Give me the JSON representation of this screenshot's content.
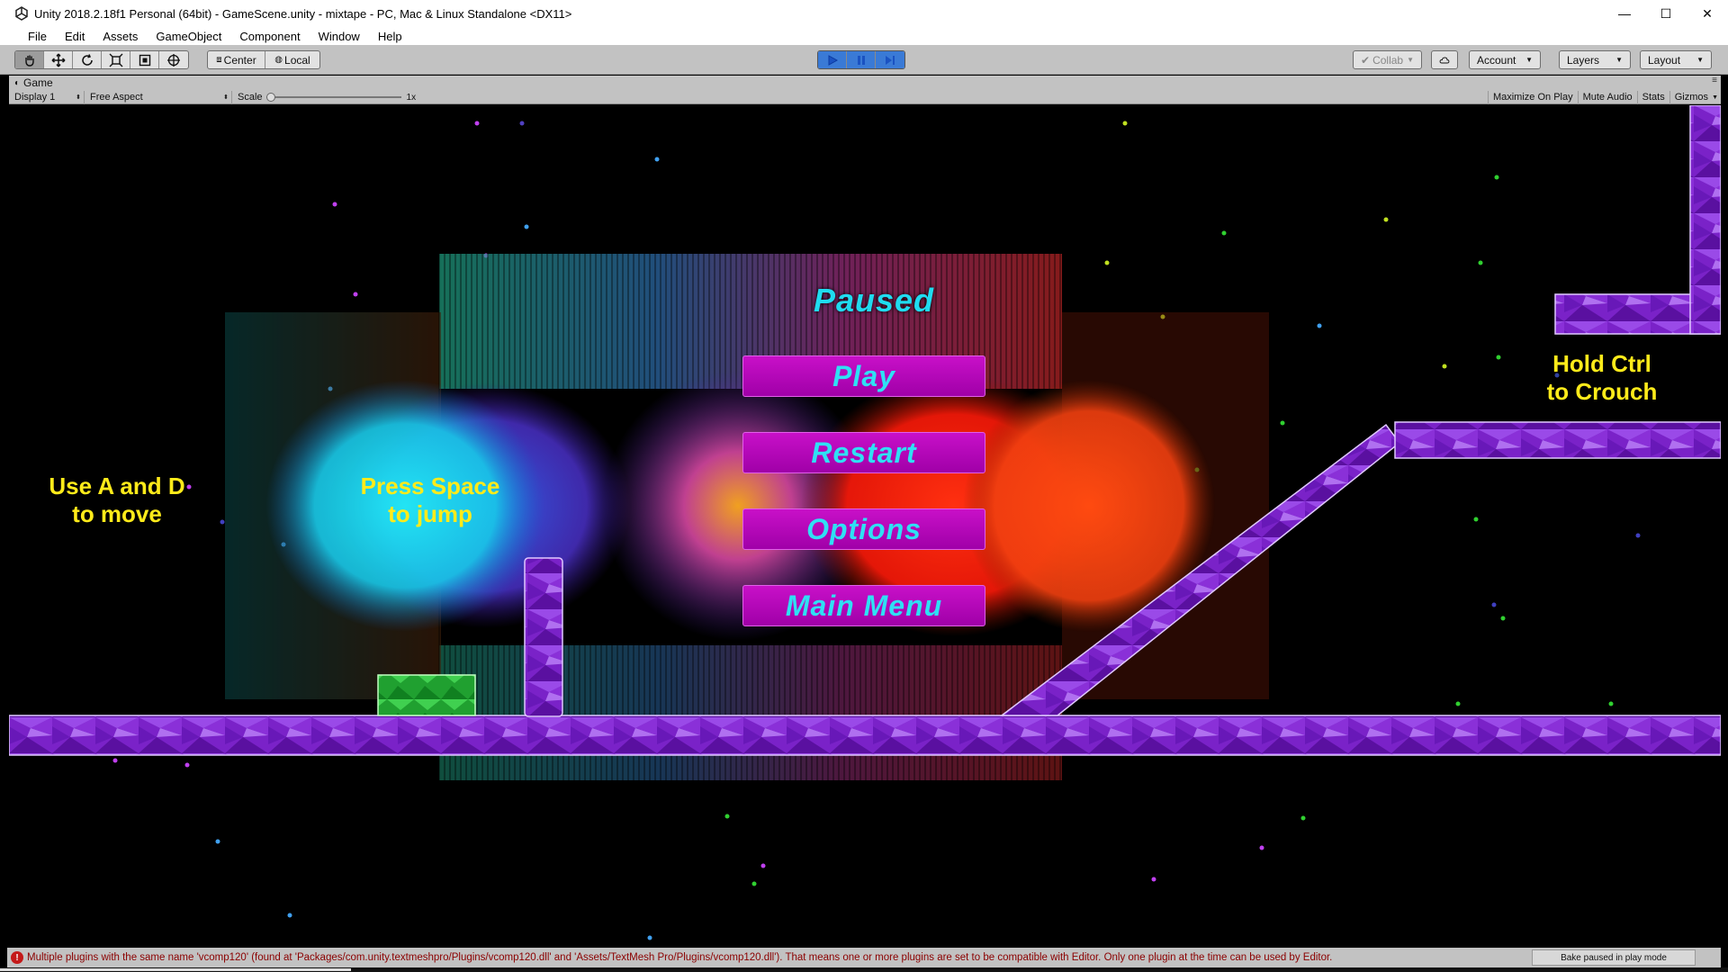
{
  "window": {
    "title": "Unity 2018.2.18f1 Personal (64bit) - GameScene.unity - mixtape - PC, Mac & Linux Standalone <DX11>",
    "minimize": "—",
    "maximize": "☐",
    "close": "✕"
  },
  "menu": [
    "File",
    "Edit",
    "Assets",
    "GameObject",
    "Component",
    "Window",
    "Help"
  ],
  "toolbar": {
    "pivot": "Center",
    "space": "Local",
    "collab": "Collab",
    "account": "Account",
    "layers": "Layers",
    "layout": "Layout"
  },
  "game_view": {
    "tab": "Game",
    "display": "Display 1",
    "aspect": "Free Aspect",
    "scale_label": "Scale",
    "scale_value": "1x",
    "maximize_on_play": "Maximize On Play",
    "mute_audio": "Mute Audio",
    "stats": "Stats",
    "gizmos": "Gizmos"
  },
  "game": {
    "paused_title": "Paused",
    "buttons": [
      "Play",
      "Restart",
      "Options",
      "Main Menu"
    ],
    "hint_move": [
      "Use A and D",
      "to move"
    ],
    "hint_jump": [
      "Press Space",
      "to jump"
    ],
    "hint_crouch": [
      "Hold Ctrl",
      "to Crouch"
    ]
  },
  "status": {
    "message": "Multiple plugins with the same name 'vcomp120' (found at 'Packages/com.unity.textmeshpro/Plugins/vcomp120.dll' and 'Assets/TextMesh Pro/Plugins/vcomp120.dll'). That means one or more plugins are set to be compatible with Editor. Only one plugin at the time can be used by Editor.",
    "bake": "Bake paused in play mode"
  },
  "colors": {
    "accent_button": "#b808b8",
    "button_text": "#2fe0f4",
    "hint_text": "#ffeb1a",
    "platform": "#8a2be2"
  }
}
